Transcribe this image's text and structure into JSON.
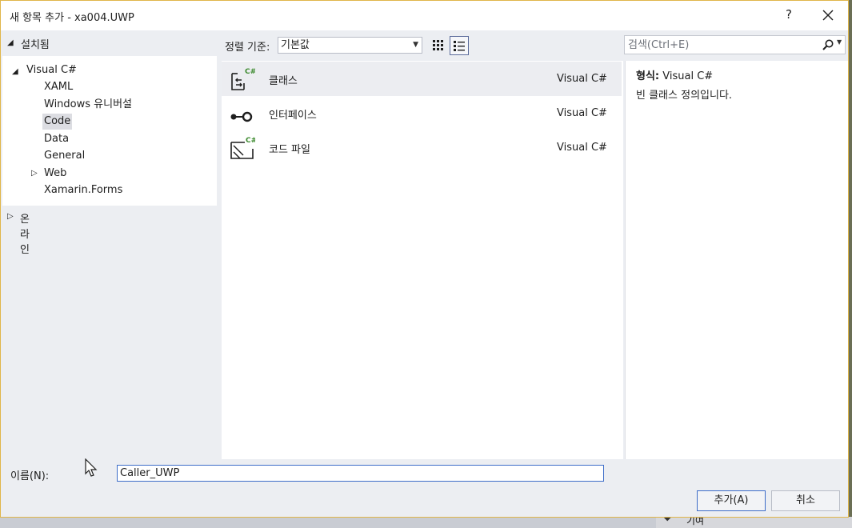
{
  "window": {
    "title": "새 항목 추가 - xa004.UWP",
    "help_label": "?"
  },
  "left_pane": {
    "installed_label": "설치됨",
    "tree": [
      {
        "label": "Visual C#",
        "expanded": true,
        "level": 0
      },
      {
        "label": "XAML",
        "level": 1
      },
      {
        "label": "Windows 유니버설",
        "level": 1
      },
      {
        "label": "Code",
        "level": 1,
        "selected": true
      },
      {
        "label": "Data",
        "level": 1
      },
      {
        "label": "General",
        "level": 1
      },
      {
        "label": "Web",
        "level": 1,
        "collapsed": true
      },
      {
        "label": "Xamarin.Forms",
        "level": 1
      }
    ],
    "online_label": "온라인"
  },
  "toolbar": {
    "sort_label": "정렬 기준:",
    "sort_value": "기본값",
    "view_grid_icon": "small-icons-view-icon",
    "view_list_icon": "list-view-icon"
  },
  "templates": [
    {
      "name": "클래스",
      "language": "Visual C#",
      "icon": "csharp-class-icon",
      "selected": true
    },
    {
      "name": "인터페이스",
      "language": "Visual C#",
      "icon": "interface-icon"
    },
    {
      "name": "코드 파일",
      "language": "Visual C#",
      "icon": "csharp-code-file-icon"
    }
  ],
  "search": {
    "placeholder": "검색(Ctrl+E)",
    "value": ""
  },
  "details": {
    "type_label": "형식:",
    "type_value": "Visual C#",
    "description": "빈 클래스 정의입니다."
  },
  "footer": {
    "name_label": "이름(N):",
    "name_value": "Caller_UWP",
    "add_label": "추가(A)",
    "cancel_label": "취소"
  },
  "background": {
    "partial_text": "기여"
  },
  "colors": {
    "accent_border": "#3d6dc8",
    "window_border": "#e0b64a",
    "dialog_bg": "#eceef2",
    "csharp_green": "#3c8a2e"
  }
}
